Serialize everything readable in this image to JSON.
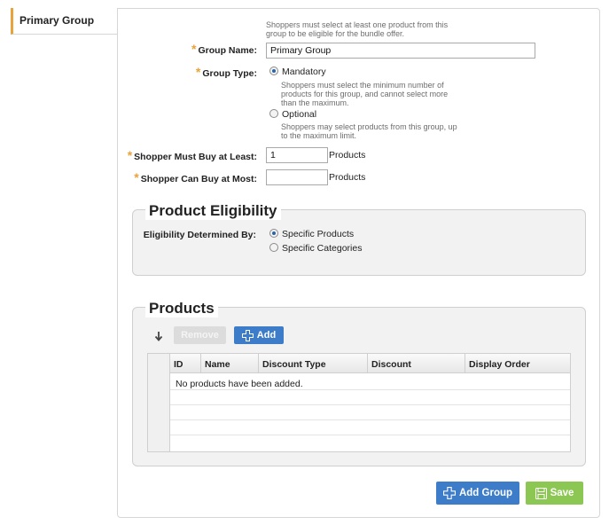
{
  "tab": {
    "label": "Primary Group",
    "accent_color": "#e8a33d"
  },
  "form": {
    "top_hint": "Shoppers must select at least one product from this group to be eligible for the bundle offer.",
    "group_name": {
      "label": "Group Name:",
      "value": "Primary Group"
    },
    "group_type": {
      "label": "Group Type:",
      "selected": "Mandatory",
      "options": [
        {
          "label": "Mandatory",
          "hint": "Shoppers must select the minimum number of products for this group, and cannot select more than the maximum."
        },
        {
          "label": "Optional",
          "hint": "Shoppers may select products from this group, up to the maximum limit."
        }
      ]
    },
    "must_buy": {
      "label": "Shopper Must Buy at Least:",
      "value": "1",
      "unit": "Products"
    },
    "can_buy": {
      "label": "Shopper Can Buy at Most:",
      "value": "",
      "unit": "Products"
    }
  },
  "eligibility": {
    "title": "Product Eligibility",
    "label": "Eligibility Determined By:",
    "selected": "Specific Products",
    "options": [
      "Specific Products",
      "Specific Categories"
    ]
  },
  "products": {
    "title": "Products",
    "remove_label": "Remove",
    "add_label": "Add",
    "columns": [
      "ID",
      "Name",
      "Discount Type",
      "Discount",
      "Display Order"
    ],
    "empty_message": "No products have been added."
  },
  "footer": {
    "add_group_label": "Add Group",
    "save_label": "Save"
  },
  "colors": {
    "primary_button": "#3d7cc9",
    "save_button": "#8cc653",
    "required_star": "#e8a33d"
  }
}
